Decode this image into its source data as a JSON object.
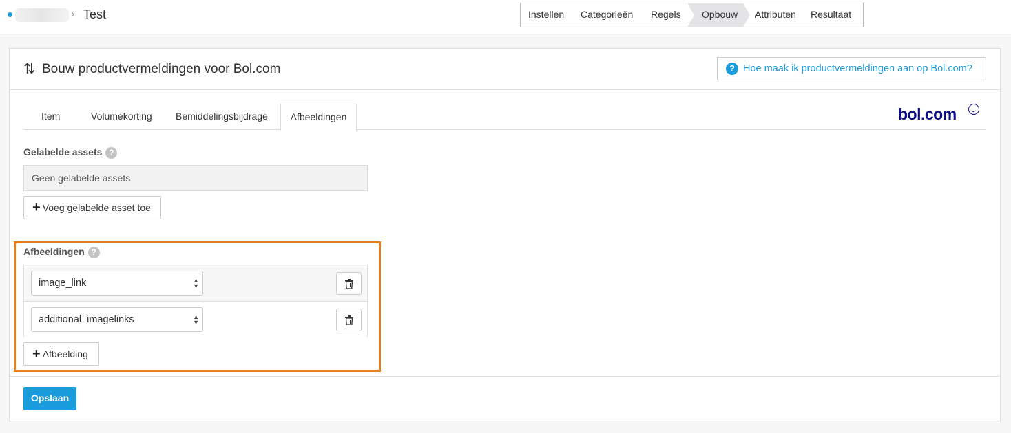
{
  "breadcrumb": {
    "separator": "›",
    "title": "Test"
  },
  "steps": [
    "Instellen",
    "Categorieën",
    "Regels",
    "Opbouw",
    "Attributen",
    "Resultaat"
  ],
  "active_step": "Opbouw",
  "panel": {
    "title": "Bouw productvermeldingen voor Bol.com",
    "help_label": "Hoe maak ik productvermeldingen aan op Bol.com?"
  },
  "tabs": [
    "Item",
    "Volumekorting",
    "Bemiddelingsbijdrage",
    "Afbeeldingen"
  ],
  "active_tab": "Afbeeldingen",
  "logo": "bol.com",
  "labeled_assets": {
    "label": "Gelabelde assets",
    "empty_text": "Geen gelabelde assets",
    "add_button": "Voeg gelabelde asset toe"
  },
  "images": {
    "label": "Afbeeldingen",
    "rows": [
      {
        "value": "image_link"
      },
      {
        "value": "additional_imagelinks"
      }
    ],
    "add_button": "Afbeelding"
  },
  "save_button": "Opslaan",
  "colors": {
    "accent": "#1a9bdc",
    "highlight": "#e67e22",
    "brand": "#0c0c86"
  }
}
